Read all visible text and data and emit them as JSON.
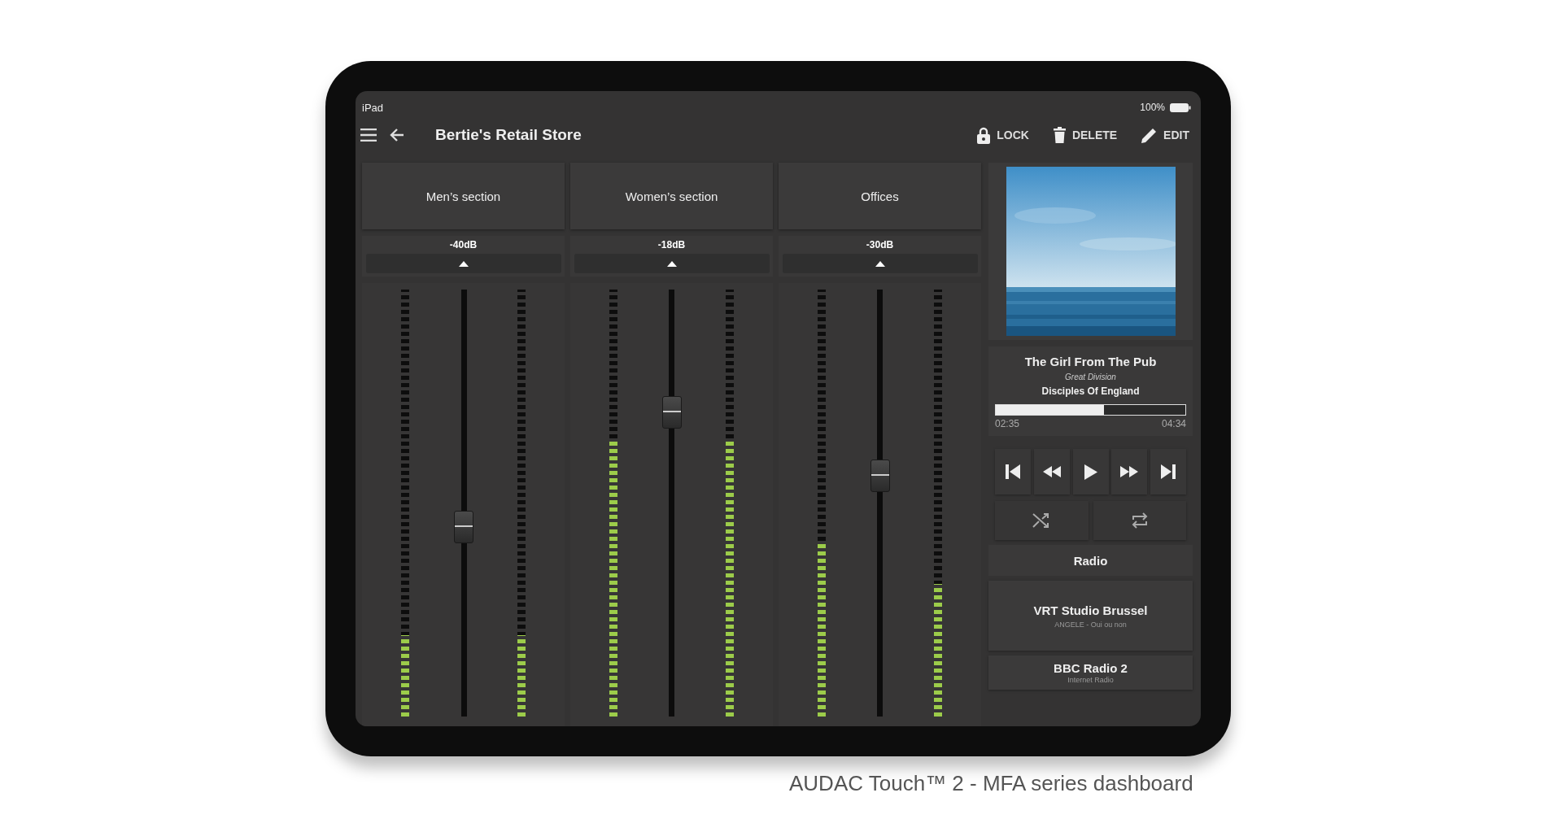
{
  "status_bar": {
    "device": "iPad",
    "battery": "100%"
  },
  "header": {
    "title": "Bertie's Retail Store",
    "actions": [
      {
        "kind": "lock",
        "label": "LOCK"
      },
      {
        "kind": "delete",
        "label": "DELETE"
      },
      {
        "kind": "edit",
        "label": "EDIT"
      }
    ]
  },
  "zones": [
    {
      "name": "Men’s section",
      "gain": "-40dB",
      "fader": {
        "level": 0.44
      },
      "meters": [
        {
          "level": 0.19
        },
        {
          "level": 0.19
        }
      ]
    },
    {
      "name": "Women’s section",
      "gain": "-18dB",
      "fader": {
        "level": 0.73
      },
      "meters": [
        {
          "level": 0.65
        },
        {
          "level": 0.65
        }
      ]
    },
    {
      "name": "Offices",
      "gain": "-30dB",
      "fader": {
        "level": 0.57
      },
      "meters": [
        {
          "level": 0.41
        },
        {
          "level": 0.31
        }
      ]
    }
  ],
  "player": {
    "track": "The Girl From The Pub",
    "album": "Great Division",
    "artist": "Disciples Of England",
    "progress": {
      "level": 0.57
    },
    "elapsed": "02:35",
    "duration": "04:34",
    "transport": [
      {
        "kind": "previous"
      },
      {
        "kind": "rewind"
      },
      {
        "kind": "play"
      },
      {
        "kind": "forward"
      },
      {
        "kind": "next"
      }
    ],
    "modes": [
      {
        "kind": "shuffle"
      },
      {
        "kind": "repeat"
      }
    ]
  },
  "radio": {
    "title": "Radio",
    "stations": [
      {
        "name": "VRT Studio Brussel",
        "subtitle": "ANGELE - Oui ou non"
      },
      {
        "name": "BBC Radio 2",
        "subtitle": "Internet Radio"
      }
    ]
  },
  "caption": "AUDAC Touch™ 2 - MFA series dashboard"
}
